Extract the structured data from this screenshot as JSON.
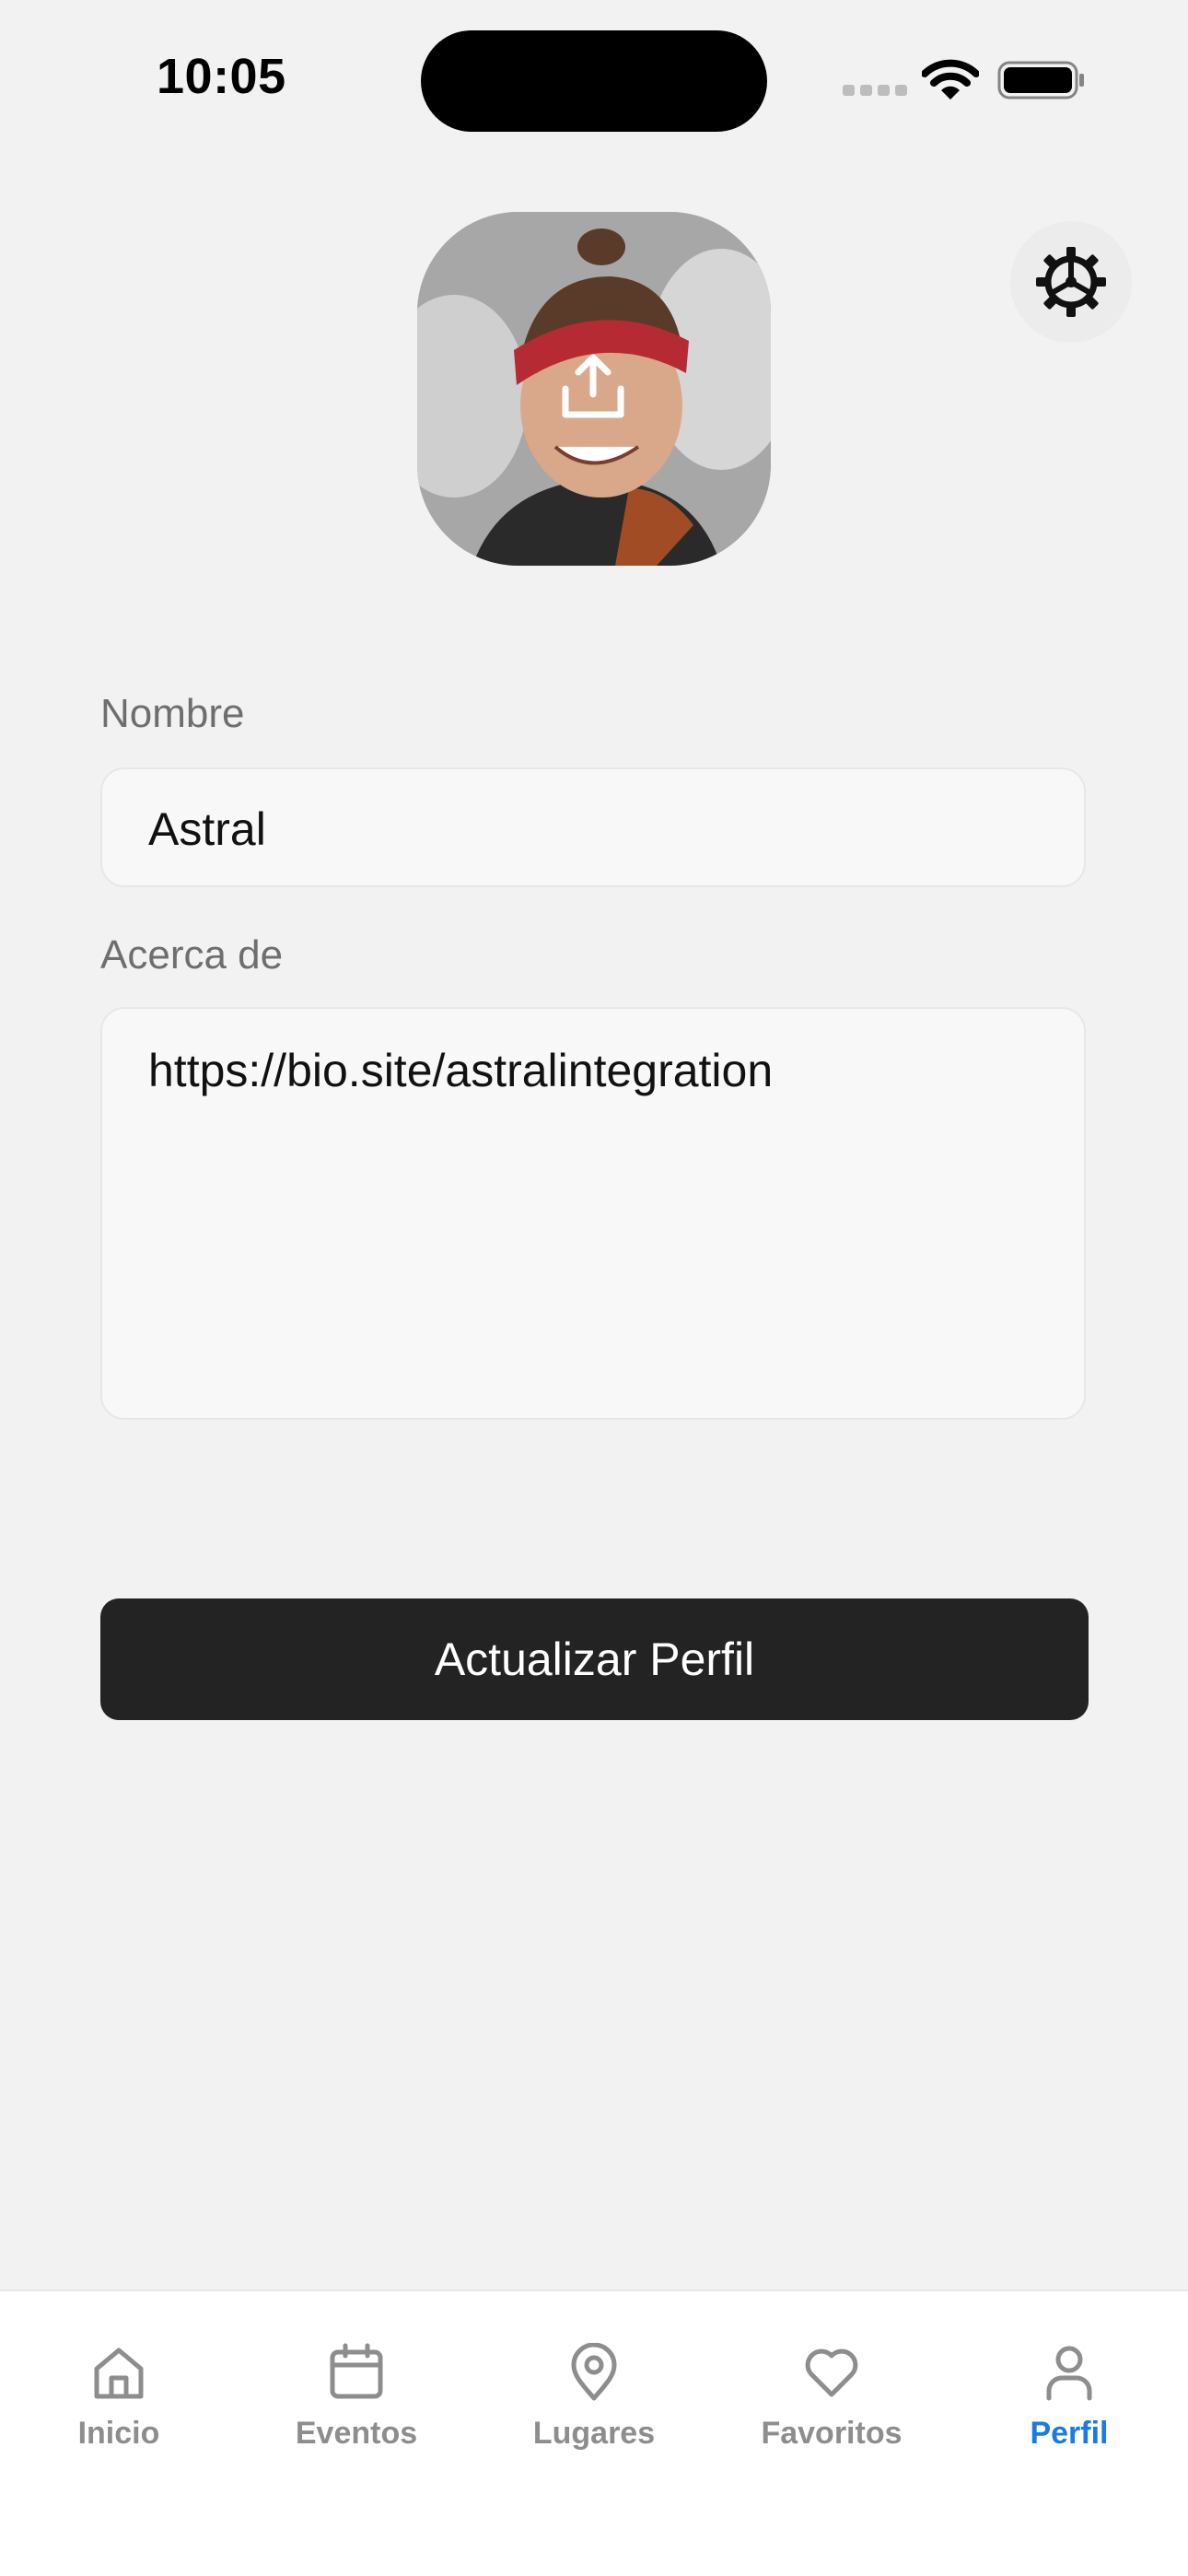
{
  "status_bar": {
    "time": "10:05"
  },
  "profile": {
    "name_label": "Nombre",
    "name_value": "Astral",
    "bio_label": "Acerca de",
    "bio_value": "https://bio.site/astralintegration",
    "update_button_label": "Actualizar Perfil"
  },
  "icons": {
    "settings": "gear-icon",
    "upload": "upload-icon"
  },
  "tabs": [
    {
      "label": "Inicio",
      "icon": "home-icon",
      "active": false
    },
    {
      "label": "Eventos",
      "icon": "calendar-icon",
      "active": false
    },
    {
      "label": "Lugares",
      "icon": "map-pin-icon",
      "active": false
    },
    {
      "label": "Favoritos",
      "icon": "heart-icon",
      "active": false
    },
    {
      "label": "Perfil",
      "icon": "person-icon",
      "active": true
    }
  ],
  "colors": {
    "background": "#f2f2f2",
    "button": "#232323",
    "active_tab": "#1a7be6",
    "inactive_tab": "#8d8d8d"
  }
}
